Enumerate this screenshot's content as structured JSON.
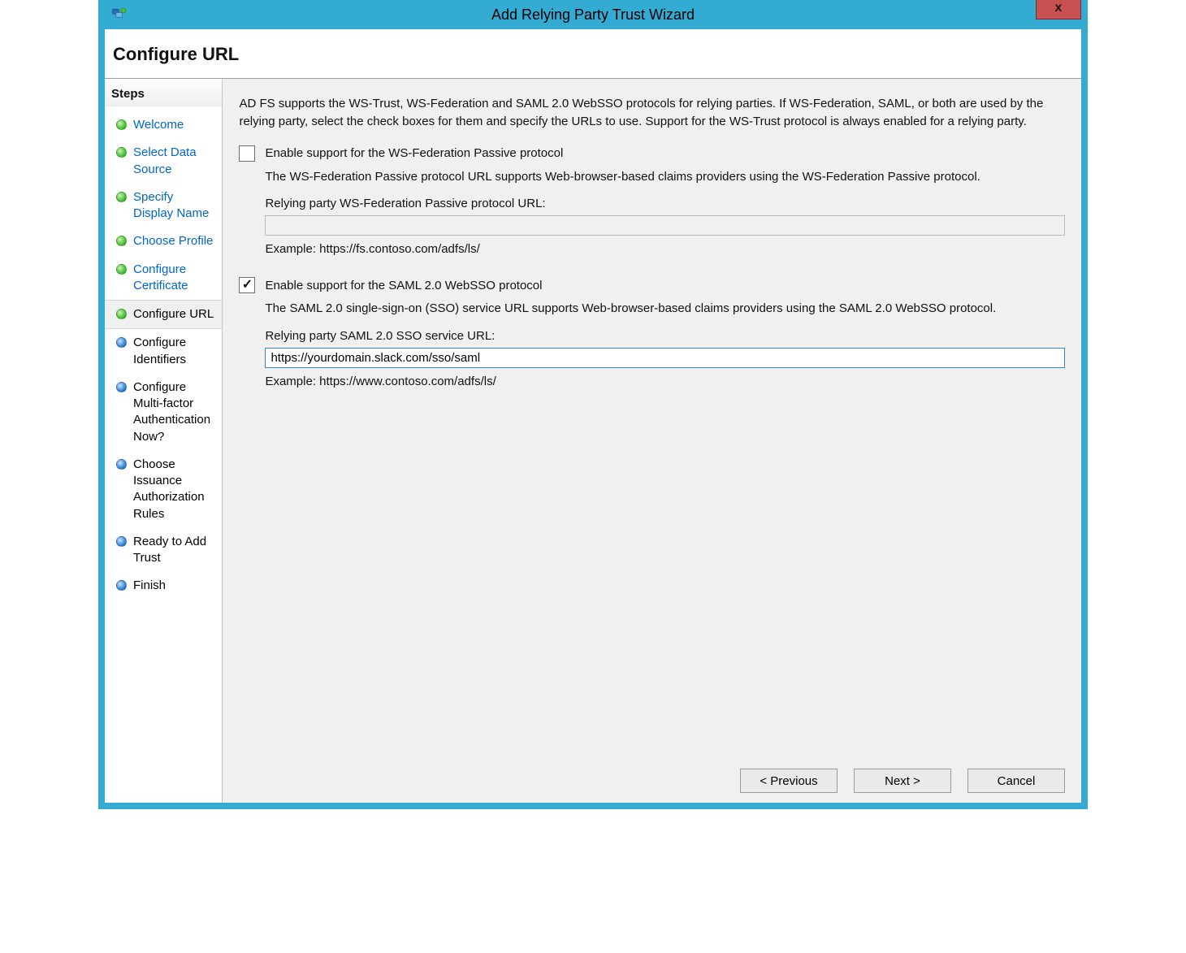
{
  "window": {
    "title": "Add Relying Party Trust Wizard",
    "close_symbol": "x"
  },
  "page_title": "Configure URL",
  "sidebar": {
    "heading": "Steps",
    "items": [
      {
        "label": "Welcome",
        "state": "done",
        "color": "green",
        "link": true
      },
      {
        "label": "Select Data Source",
        "state": "done",
        "color": "green",
        "link": true
      },
      {
        "label": "Specify Display Name",
        "state": "done",
        "color": "green",
        "link": true
      },
      {
        "label": "Choose Profile",
        "state": "done",
        "color": "green",
        "link": true
      },
      {
        "label": "Configure Certificate",
        "state": "done",
        "color": "green",
        "link": true
      },
      {
        "label": "Configure URL",
        "state": "current",
        "color": "green",
        "link": false
      },
      {
        "label": "Configure Identifiers",
        "state": "future",
        "color": "blue",
        "link": false
      },
      {
        "label": "Configure Multi-factor Authentication Now?",
        "state": "future",
        "color": "blue",
        "link": false
      },
      {
        "label": "Choose Issuance Authorization Rules",
        "state": "future",
        "color": "blue",
        "link": false
      },
      {
        "label": "Ready to Add Trust",
        "state": "future",
        "color": "blue",
        "link": false
      },
      {
        "label": "Finish",
        "state": "future",
        "color": "blue",
        "link": false
      }
    ]
  },
  "content": {
    "intro": "AD FS supports the WS-Trust, WS-Federation and SAML 2.0 WebSSO protocols for relying parties.  If WS-Federation, SAML, or both are used by the relying party, select the check boxes for them and specify the URLs to use.  Support for the WS-Trust protocol is always enabled for a relying party.",
    "wsfed": {
      "checkbox_label": "Enable support for the WS-Federation Passive protocol",
      "checked": false,
      "description": "The WS-Federation Passive protocol URL supports Web-browser-based claims providers using the WS-Federation Passive protocol.",
      "field_label": "Relying party WS-Federation Passive protocol URL:",
      "field_value": "",
      "example": "Example: https://fs.contoso.com/adfs/ls/"
    },
    "saml": {
      "checkbox_label": "Enable support for the SAML 2.0 WebSSO protocol",
      "checked": true,
      "description": "The SAML 2.0 single-sign-on (SSO) service URL supports Web-browser-based claims providers using the SAML 2.0 WebSSO protocol.",
      "field_label": "Relying party SAML 2.0 SSO service URL:",
      "field_value": "https://yourdomain.slack.com/sso/saml",
      "example": "Example: https://www.contoso.com/adfs/ls/"
    }
  },
  "buttons": {
    "previous": "< Previous",
    "next": "Next >",
    "cancel": "Cancel"
  }
}
